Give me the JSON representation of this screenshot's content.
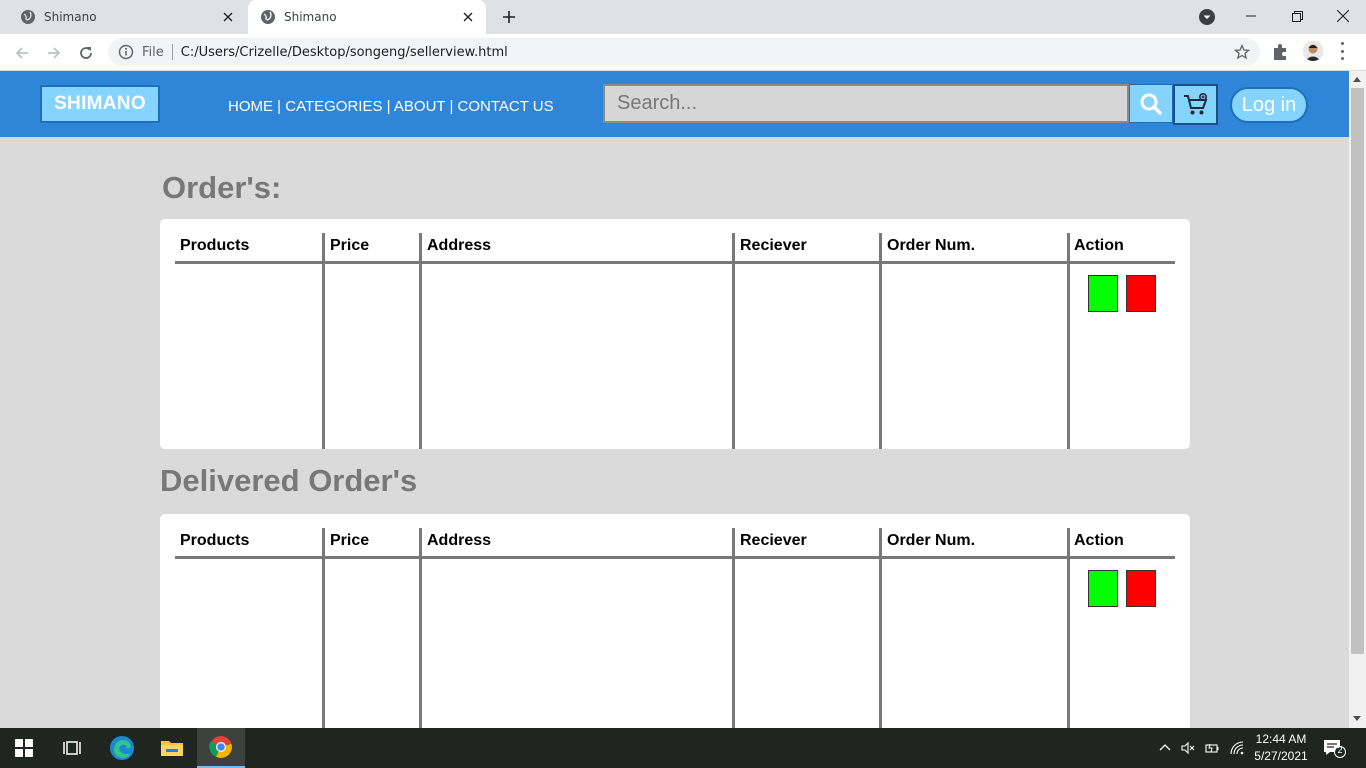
{
  "browser": {
    "tabs": [
      {
        "title": "Shimano"
      },
      {
        "title": "Shimano"
      }
    ],
    "address": {
      "scheme_label": "File",
      "url": "C:/Users/Crizelle/Desktop/songeng/sellerview.html"
    }
  },
  "header": {
    "logo": "SHIMANO",
    "nav": {
      "home": "HOME",
      "categories": "CATEGORIES",
      "about": "ABOUT",
      "contact": "CONTACT US",
      "separator": " | "
    },
    "search_placeholder": "Search...",
    "login_label": "Log in"
  },
  "orders": {
    "title": "Order's:",
    "columns": [
      "Products",
      "Price",
      "Address",
      "Reciever",
      "Order Num.",
      "Action"
    ]
  },
  "delivered": {
    "title": "Delivered Order's",
    "columns": [
      "Products",
      "Price",
      "Address",
      "Reciever",
      "Order Num.",
      "Action"
    ]
  },
  "colors": {
    "header_bg": "#2f86d8",
    "accent_light": "#85d3ff",
    "approve": "#00ff00",
    "reject": "#ff0000",
    "page_bg": "#dadada"
  },
  "taskbar": {
    "time": "12:44 AM",
    "date": "5/27/2021",
    "notification_count": "2"
  }
}
